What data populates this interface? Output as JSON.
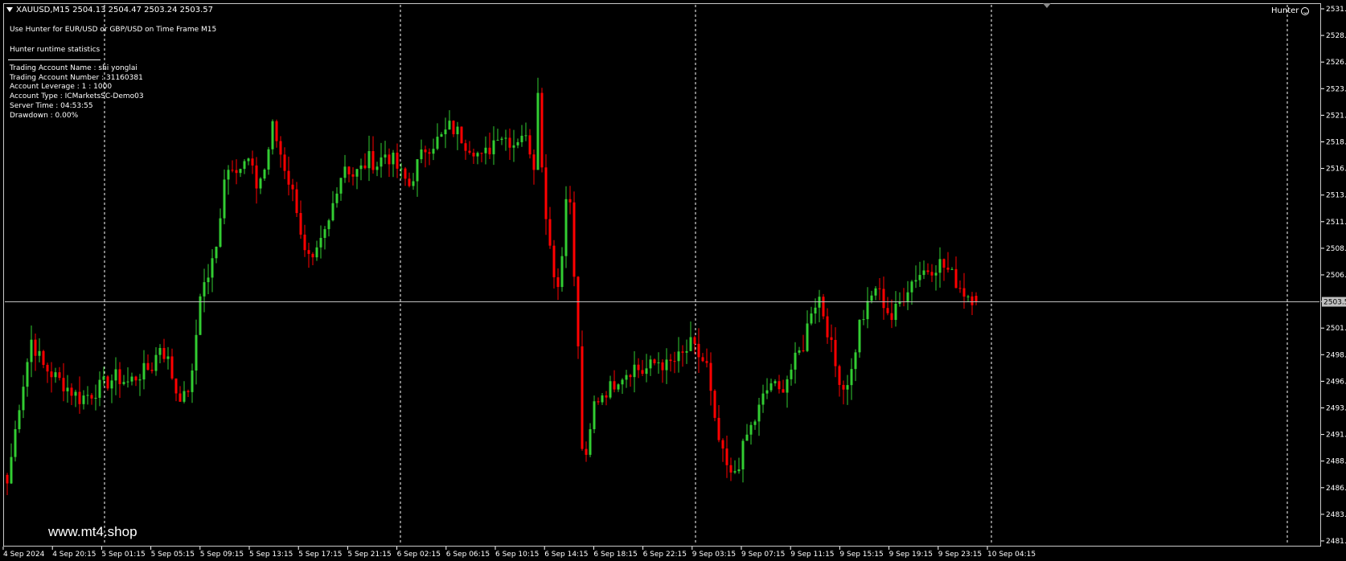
{
  "header": {
    "symbol_line": "XAUUSD,M15  2504.13 2504.47 2503.24 2503.57",
    "note": "Use Hunter for EUR/USD or GBP/USD on Time Frame M15"
  },
  "stats": {
    "title": "Hunter runtime statistics",
    "rows": [
      "Trading Account Name  : shi yonglai",
      "Trading Account Number  : 31160381",
      "Account Leverage  :  1 : 1000",
      "Account Type  :  ICMarketsSC-Demo03",
      "Server Time  :  04:53:55",
      "Drawdown  :  0.00%"
    ]
  },
  "indicator": {
    "name": "Hunter",
    "icon": "smiley-face-icon"
  },
  "watermark": "www.mt4.shop",
  "colors": {
    "background": "#000000",
    "bull": "#32cd32",
    "bear": "#ff0000",
    "grid": "#ffffff"
  },
  "chart_data": {
    "type": "candlestick",
    "symbol": "XAUUSD",
    "timeframe": "M15",
    "ylim": [
      2481.1,
      2531.1
    ],
    "y_ticks": [
      2531.1,
      2528.6,
      2526.1,
      2523.6,
      2521.1,
      2518.6,
      2516.1,
      2513.6,
      2511.1,
      2508.6,
      2506.1,
      2503.6,
      2501.1,
      2498.6,
      2496.1,
      2493.6,
      2491.1,
      2488.6,
      2486.1,
      2483.6,
      2481.1
    ],
    "x_ticks": [
      "4 Sep 2024",
      "4 Sep 20:15",
      "5 Sep 01:15",
      "5 Sep 05:15",
      "5 Sep 09:15",
      "5 Sep 13:15",
      "5 Sep 17:15",
      "5 Sep 21:15",
      "6 Sep 02:15",
      "6 Sep 06:15",
      "6 Sep 10:15",
      "6 Sep 14:15",
      "6 Sep 18:15",
      "6 Sep 22:15",
      "9 Sep 03:15",
      "9 Sep 07:15",
      "9 Sep 11:15",
      "9 Sep 15:15",
      "9 Sep 19:15",
      "9 Sep 23:15",
      "10 Sep 04:15"
    ],
    "current_price": 2503.57,
    "last_bar": {
      "open": 2504.13,
      "high": 2504.47,
      "low": 2503.24,
      "close": 2503.57
    },
    "close_path": [
      [
        0,
        2486.5
      ],
      [
        3,
        2494.0
      ],
      [
        6,
        2500.0
      ],
      [
        9,
        2497.5
      ],
      [
        12,
        2496.5
      ],
      [
        15,
        2495.5
      ],
      [
        18,
        2494.5
      ],
      [
        21,
        2495.0
      ],
      [
        24,
        2495.8
      ],
      [
        27,
        2496.5
      ],
      [
        30,
        2496.0
      ],
      [
        33,
        2496.8
      ],
      [
        36,
        2497.5
      ],
      [
        38,
        2499.5
      ],
      [
        40,
        2498.0
      ],
      [
        42,
        2495.2
      ],
      [
        44,
        2494.5
      ],
      [
        46,
        2496.5
      ],
      [
        48,
        2504.5
      ],
      [
        50,
        2506.0
      ],
      [
        52,
        2508.5
      ],
      [
        54,
        2515.5
      ],
      [
        56,
        2516.6
      ],
      [
        58,
        2516.2
      ],
      [
        60,
        2516.8
      ],
      [
        62,
        2514.5
      ],
      [
        64,
        2516.0
      ],
      [
        66,
        2520.0
      ],
      [
        68,
        2517.5
      ],
      [
        70,
        2515.0
      ],
      [
        72,
        2512.5
      ],
      [
        74,
        2508.0
      ],
      [
        76,
        2507.0
      ],
      [
        78,
        2509.0
      ],
      [
        80,
        2511.0
      ],
      [
        82,
        2514.5
      ],
      [
        84,
        2516.5
      ],
      [
        86,
        2515.5
      ],
      [
        88,
        2516.0
      ],
      [
        90,
        2517.0
      ],
      [
        92,
        2516.5
      ],
      [
        94,
        2517.5
      ],
      [
        96,
        2516.8
      ],
      [
        98,
        2515.5
      ],
      [
        100,
        2514.5
      ],
      [
        102,
        2516.5
      ],
      [
        104,
        2518.0
      ],
      [
        106,
        2518.5
      ],
      [
        108,
        2519.0
      ],
      [
        110,
        2520.0
      ],
      [
        112,
        2519.5
      ],
      [
        114,
        2518.5
      ],
      [
        116,
        2518.0
      ],
      [
        118,
        2517.0
      ],
      [
        120,
        2518.0
      ],
      [
        122,
        2519.5
      ],
      [
        124,
        2519.0
      ],
      [
        126,
        2518.5
      ],
      [
        128,
        2519.5
      ],
      [
        130,
        2518.0
      ],
      [
        131,
        2516.5
      ],
      [
        132,
        2524.0
      ],
      [
        133,
        2516.0
      ],
      [
        134,
        2512.0
      ],
      [
        135,
        2509.0
      ],
      [
        136,
        2506.5
      ],
      [
        137,
        2505.0
      ],
      [
        138,
        2508.0
      ],
      [
        139,
        2514.0
      ],
      [
        140,
        2512.5
      ],
      [
        141,
        2506.0
      ],
      [
        142,
        2499.0
      ],
      [
        143,
        2490.0
      ],
      [
        144,
        2488.5
      ],
      [
        146,
        2494.0
      ],
      [
        148,
        2495.0
      ],
      [
        150,
        2495.5
      ],
      [
        152,
        2496.5
      ],
      [
        154,
        2497.0
      ],
      [
        156,
        2497.5
      ],
      [
        158,
        2497.0
      ],
      [
        160,
        2497.5
      ],
      [
        162,
        2498.0
      ],
      [
        164,
        2497.5
      ],
      [
        166,
        2498.0
      ],
      [
        168,
        2498.5
      ],
      [
        170,
        2499.5
      ],
      [
        172,
        2498.5
      ],
      [
        174,
        2497.5
      ],
      [
        176,
        2492.0
      ],
      [
        178,
        2489.0
      ],
      [
        180,
        2487.0
      ],
      [
        182,
        2488.5
      ],
      [
        184,
        2491.0
      ],
      [
        186,
        2492.5
      ],
      [
        188,
        2494.5
      ],
      [
        190,
        2496.0
      ],
      [
        192,
        2495.0
      ],
      [
        194,
        2496.5
      ],
      [
        196,
        2498.0
      ],
      [
        198,
        2499.5
      ],
      [
        200,
        2503.0
      ],
      [
        202,
        2504.0
      ],
      [
        204,
        2501.0
      ],
      [
        206,
        2497.5
      ],
      [
        208,
        2495.5
      ],
      [
        210,
        2497.0
      ],
      [
        212,
        2501.5
      ],
      [
        214,
        2503.0
      ],
      [
        216,
        2505.0
      ],
      [
        218,
        2503.5
      ],
      [
        220,
        2502.0
      ],
      [
        222,
        2503.5
      ],
      [
        224,
        2505.0
      ],
      [
        226,
        2506.0
      ],
      [
        228,
        2506.5
      ],
      [
        230,
        2506.8
      ],
      [
        232,
        2507.2
      ],
      [
        234,
        2506.5
      ],
      [
        236,
        2505.5
      ],
      [
        238,
        2504.5
      ],
      [
        240,
        2504.0
      ],
      [
        241,
        2503.57
      ]
    ]
  }
}
